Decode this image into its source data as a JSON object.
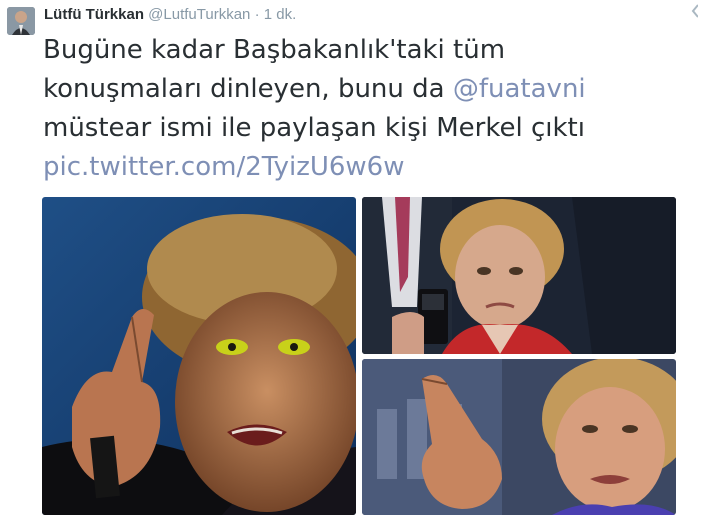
{
  "tweet": {
    "author": {
      "fullname": "Lütfü Türkkan",
      "screen_name": "@LutfuTurkkan",
      "separator": "·",
      "timestamp": "1 dk."
    },
    "text": {
      "line1": "Bugüne kadar Başbakanlık'taki tüm",
      "line2_prefix": "konuşmaları dinleyen, bunu da ",
      "mention": "@fuatavni",
      "line3": "müstear ismi ile paylaşan kişi Merkel çıktı",
      "link": "pic.twitter.com/2TyizU6w6w"
    },
    "colors": {
      "text": "#292f33",
      "meta": "#8899a6",
      "link": "#7e8fb5"
    }
  }
}
